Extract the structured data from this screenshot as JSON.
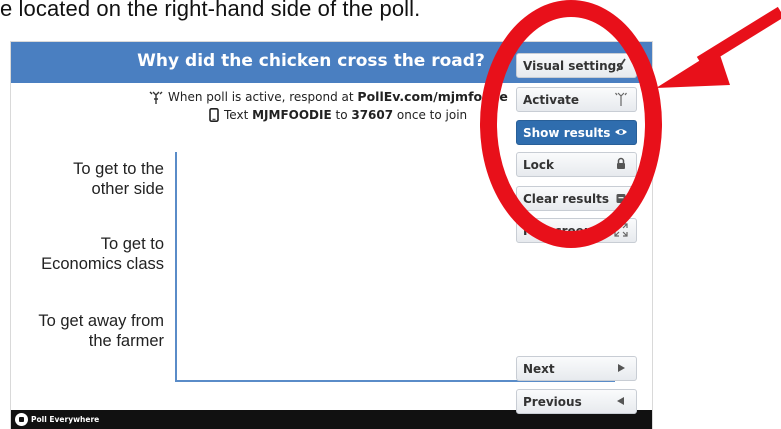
{
  "caption": "e located on the right-hand side of the poll.",
  "poll": {
    "title": "Why did the chicken cross the road?",
    "respond_prefix": "When poll is active, respond at ",
    "respond_url": "PollEv.com/mjmfoo  ie",
    "text_prefix": "Text ",
    "text_keyword": "MJMFOODIE",
    "text_mid": " to ",
    "text_number": "37607",
    "text_suffix": " once to join",
    "answers": [
      {
        "line1": "To get to the",
        "line2": "other side"
      },
      {
        "line1": "To get to",
        "line2": "Economics class"
      },
      {
        "line1": "To get away from",
        "line2": "the farmer"
      }
    ]
  },
  "footer": {
    "brand": "Poll Everywhere"
  },
  "controls": {
    "visual_settings": "Visual settings",
    "activate": "Activate",
    "show_results": "Show results",
    "lock": "Lock",
    "clear_results": "Clear results",
    "fullscreen": "Fullscreen",
    "next": "Next",
    "previous": "Previous"
  },
  "colors": {
    "title_bar": "#4a7fc1",
    "primary_button": "#2f6dae",
    "annotation": "#e8101a"
  },
  "icons": [
    "pencil-icon",
    "antenna-icon",
    "eye-icon",
    "lock-icon",
    "trash-icon",
    "expand-icon",
    "play-right-icon",
    "play-left-icon",
    "phone-icon",
    "poll-everywhere-logo"
  ]
}
